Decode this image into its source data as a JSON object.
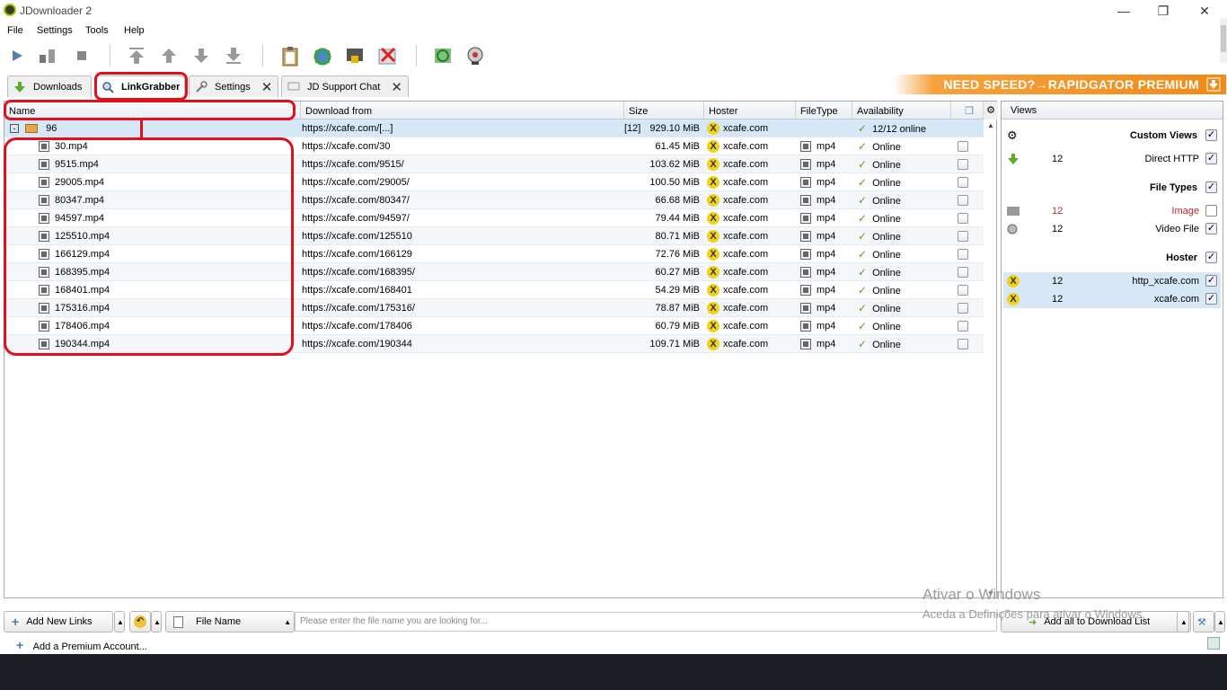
{
  "window": {
    "title": "JDownloader 2"
  },
  "menu": [
    "File",
    "Settings",
    "Tools",
    "Help"
  ],
  "tabs": {
    "downloads": "Downloads",
    "linkgrabber": "LinkGrabber",
    "settings": "Settings",
    "support": "JD Support Chat"
  },
  "banner": "NEED SPEED?→RAPIDGATOR PREMIUM",
  "columns": {
    "name": "Name",
    "from": "Download from",
    "size": "Size",
    "hoster": "Hoster",
    "filetype": "FileType",
    "availability": "Availability"
  },
  "package": {
    "name": "96",
    "url": "https://xcafe.com/[...]",
    "count": "[12]",
    "size": "929.10 MiB",
    "hoster": "xcafe.com",
    "availability": "12/12 online"
  },
  "files": [
    {
      "name": "30.mp4",
      "url": "https://xcafe.com/30",
      "size": "61.45 MiB",
      "hoster": "xcafe.com",
      "type": "mp4",
      "avail": "Online"
    },
    {
      "name": "9515.mp4",
      "url": "https://xcafe.com/9515/",
      "size": "103.62 MiB",
      "hoster": "xcafe.com",
      "type": "mp4",
      "avail": "Online"
    },
    {
      "name": "29005.mp4",
      "url": "https://xcafe.com/29005/",
      "size": "100.50 MiB",
      "hoster": "xcafe.com",
      "type": "mp4",
      "avail": "Online"
    },
    {
      "name": "80347.mp4",
      "url": "https://xcafe.com/80347/",
      "size": "66.68 MiB",
      "hoster": "xcafe.com",
      "type": "mp4",
      "avail": "Online"
    },
    {
      "name": "94597.mp4",
      "url": "https://xcafe.com/94597/",
      "size": "79.44 MiB",
      "hoster": "xcafe.com",
      "type": "mp4",
      "avail": "Online"
    },
    {
      "name": "125510.mp4",
      "url": "https://xcafe.com/125510",
      "size": "80.71 MiB",
      "hoster": "xcafe.com",
      "type": "mp4",
      "avail": "Online"
    },
    {
      "name": "166129.mp4",
      "url": "https://xcafe.com/166129",
      "size": "72.76 MiB",
      "hoster": "xcafe.com",
      "type": "mp4",
      "avail": "Online"
    },
    {
      "name": "168395.mp4",
      "url": "https://xcafe.com/168395/",
      "size": "60.27 MiB",
      "hoster": "xcafe.com",
      "type": "mp4",
      "avail": "Online"
    },
    {
      "name": "168401.mp4",
      "url": "https://xcafe.com/168401",
      "size": "54.29 MiB",
      "hoster": "xcafe.com",
      "type": "mp4",
      "avail": "Online"
    },
    {
      "name": "175316.mp4",
      "url": "https://xcafe.com/175316/",
      "size": "78.87 MiB",
      "hoster": "xcafe.com",
      "type": "mp4",
      "avail": "Online"
    },
    {
      "name": "178406.mp4",
      "url": "https://xcafe.com/178406",
      "size": "60.79 MiB",
      "hoster": "xcafe.com",
      "type": "mp4",
      "avail": "Online"
    },
    {
      "name": "190344.mp4",
      "url": "https://xcafe.com/190344",
      "size": "109.71 MiB",
      "hoster": "xcafe.com",
      "type": "mp4",
      "avail": "Online"
    }
  ],
  "views": {
    "title": "Views",
    "custom_views": "Custom Views",
    "direct_http": {
      "count": "12",
      "label": "Direct HTTP"
    },
    "file_types": "File Types",
    "image": {
      "count": "12",
      "label": "Image"
    },
    "video": {
      "count": "12",
      "label": "Video File"
    },
    "hoster": "Hoster",
    "http_xcafe": {
      "count": "12",
      "label": "http_xcafe.com"
    },
    "xcafe": {
      "count": "12",
      "label": "xcafe.com"
    }
  },
  "bottom": {
    "add_links": "Add New Links",
    "filter_label": "File Name",
    "search_placeholder": "Please enter the file name you are looking for...",
    "add_all": "Add all to Download List",
    "premium": "Add a Premium Account..."
  },
  "watermark": {
    "line1": "Ativar o Windows",
    "line2": "Aceda a Definições para ativar o Windows."
  }
}
